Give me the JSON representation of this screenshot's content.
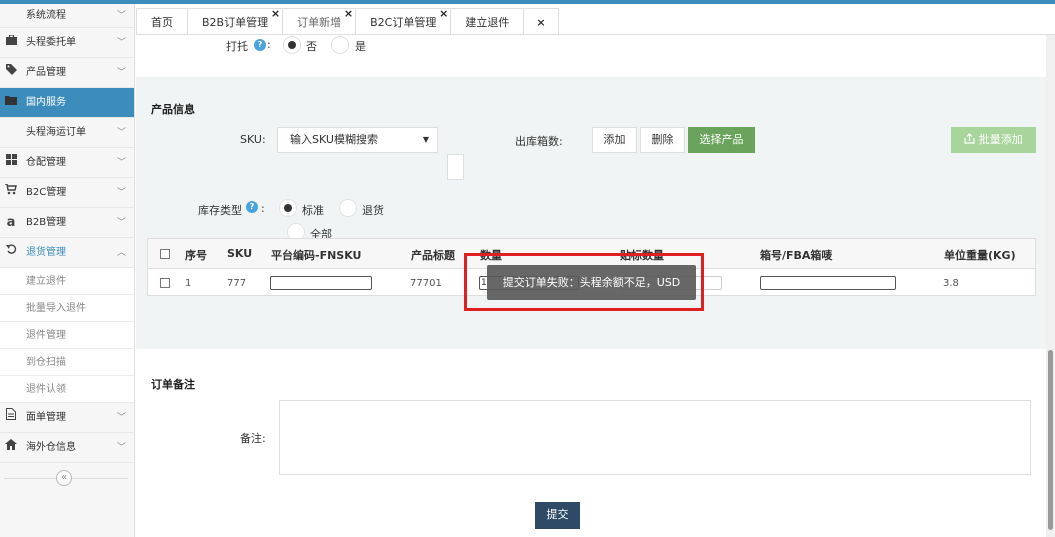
{
  "sidebar": {
    "items": [
      {
        "label": "系统流程",
        "icon": "",
        "chevron": "﹀"
      },
      {
        "label": "头程委托单",
        "icon": "briefcase-icon",
        "chevron": "﹀"
      },
      {
        "label": "产品管理",
        "icon": "tag-icon",
        "chevron": "﹀"
      },
      {
        "label": "国内服务",
        "icon": "folder-icon",
        "chevron": ""
      },
      {
        "label": "头程海运订单",
        "icon": "",
        "chevron": "﹀"
      },
      {
        "label": "仓配管理",
        "icon": "grid-icon",
        "chevron": "﹀"
      },
      {
        "label": "B2C管理",
        "icon": "cart-icon",
        "chevron": "﹀"
      },
      {
        "label": "B2B管理",
        "icon": "amazon-icon",
        "chevron": "﹀"
      },
      {
        "label": "退货管理",
        "icon": "undo-icon",
        "chevron": "︿"
      }
    ],
    "sub_items": [
      "建立退件",
      "批量导入退件",
      "退件管理",
      "到仓扫描",
      "退件认领"
    ],
    "items_after": [
      {
        "label": "面单管理",
        "icon": "document-icon",
        "chevron": "﹀"
      },
      {
        "label": "海外仓信息",
        "icon": "home-icon",
        "chevron": "﹀"
      }
    ],
    "collapse_symbol": "«"
  },
  "tabs": [
    {
      "label": "首页",
      "closable": false
    },
    {
      "label": "B2B订单管理",
      "closable": true
    },
    {
      "label": "订单新增",
      "closable": true,
      "active": true
    },
    {
      "label": "B2C订单管理",
      "closable": true
    },
    {
      "label": "建立退件",
      "closable": false
    }
  ],
  "tab_close_all": "×",
  "tab_close_symbol": "×",
  "pallet": {
    "label": "打托",
    "colon": ":",
    "options": [
      "否",
      "是"
    ],
    "selected": "否"
  },
  "product_info": {
    "title": "产品信息",
    "sku_label": "SKU:",
    "sku_select_value": "输入SKU模糊搜索",
    "outbound_cartons_label": "出库箱数:",
    "add_button": "添加",
    "delete_button": "删除",
    "select_product_button": "选择产品",
    "bulk_add_button": "批量添加",
    "inventory_type_label": "库存类型",
    "inventory_colon": ":",
    "inventory_options": [
      "标准",
      "退货",
      "全部"
    ],
    "inventory_selected": "标准"
  },
  "table": {
    "headers": [
      "序号",
      "SKU",
      "平台编码-FNSKU",
      "产品标题",
      "数量",
      "贴标数量",
      "箱号/FBA箱唛",
      "单位重量(KG)"
    ],
    "rows": [
      {
        "index": "1",
        "sku": "777",
        "fnsku": "",
        "title": "77701",
        "qty": "1",
        "label_qty": "",
        "box": "",
        "weight": "3.8"
      }
    ]
  },
  "toast": {
    "message": "提交订单失败：头程余额不足，USD"
  },
  "remarks": {
    "title": "订单备注",
    "label": "备注:",
    "value": ""
  },
  "submit_button": "提交",
  "colors": {
    "brand": "#3c8dbc",
    "green": "#6aa35b",
    "alert_border": "#e02020"
  }
}
